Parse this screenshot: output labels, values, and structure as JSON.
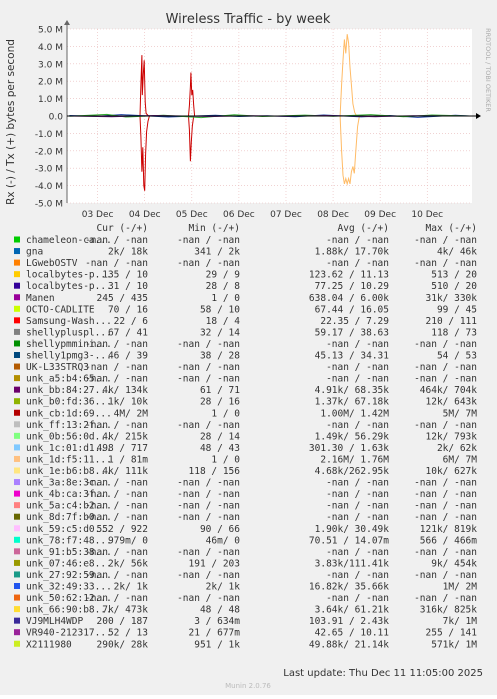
{
  "chart_data": {
    "type": "line",
    "title": "Wireless Traffic - by week",
    "ylabel": "Rx (-) / Tx (+) bytes per second",
    "side_label": "RRDTOOL / TOBI OETIKER",
    "ylim": [
      -5000000,
      5000000
    ],
    "y_ticks": [
      {
        "value": 5000000,
        "label": "5.0 M"
      },
      {
        "value": 4000000,
        "label": "4.0 M"
      },
      {
        "value": 3000000,
        "label": "3.0 M"
      },
      {
        "value": 2000000,
        "label": "2.0 M"
      },
      {
        "value": 1000000,
        "label": "1.0 M"
      },
      {
        "value": 0,
        "label": "0.0"
      },
      {
        "value": -1000000,
        "label": "-1.0 M"
      },
      {
        "value": -2000000,
        "label": "-2.0 M"
      },
      {
        "value": -3000000,
        "label": "-3.0 M"
      },
      {
        "value": -4000000,
        "label": "-4.0 M"
      },
      {
        "value": -5000000,
        "label": "-5.0 M"
      }
    ],
    "xlim": [
      2.35,
      10.95
    ],
    "x_ticks": [
      {
        "value": 3,
        "label": "03 Dec"
      },
      {
        "value": 4,
        "label": "04 Dec"
      },
      {
        "value": 5,
        "label": "05 Dec"
      },
      {
        "value": 6,
        "label": "06 Dec"
      },
      {
        "value": 7,
        "label": "07 Dec"
      },
      {
        "value": 8,
        "label": "08 Dec"
      },
      {
        "value": 9,
        "label": "09 Dec"
      },
      {
        "value": 10,
        "label": "10 Dec"
      }
    ],
    "grid": true,
    "series": [
      {
        "name": "red_tx",
        "color": "#cc0000",
        "points": [
          [
            3.9,
            0
          ],
          [
            3.92,
            1800000
          ],
          [
            3.94,
            3500000
          ],
          [
            3.95,
            1200000
          ],
          [
            3.97,
            2400000
          ],
          [
            3.99,
            3200000
          ],
          [
            4.01,
            800000
          ],
          [
            4.03,
            150000
          ],
          [
            4.08,
            0
          ],
          [
            4.93,
            0
          ],
          [
            4.95,
            600000
          ],
          [
            4.97,
            1700000
          ],
          [
            4.98,
            2500000
          ],
          [
            5.0,
            1200000
          ],
          [
            5.02,
            1500000
          ],
          [
            5.04,
            600000
          ],
          [
            5.06,
            0
          ]
        ]
      },
      {
        "name": "red_rx",
        "color": "#cc0000",
        "points": [
          [
            3.9,
            0
          ],
          [
            3.92,
            -1200000
          ],
          [
            3.94,
            -3200000
          ],
          [
            3.96,
            -1800000
          ],
          [
            3.98,
            -4000000
          ],
          [
            4.0,
            -4300000
          ],
          [
            4.02,
            -2200000
          ],
          [
            4.04,
            -900000
          ],
          [
            4.07,
            -300000
          ],
          [
            4.1,
            0
          ],
          [
            4.93,
            0
          ],
          [
            4.95,
            -800000
          ],
          [
            4.97,
            -2600000
          ],
          [
            4.99,
            -1500000
          ],
          [
            5.01,
            -600000
          ],
          [
            5.04,
            0
          ]
        ]
      },
      {
        "name": "orange_tx",
        "color": "#ffbb66",
        "points": [
          [
            8.15,
            0
          ],
          [
            8.18,
            1800000
          ],
          [
            8.21,
            3200000
          ],
          [
            8.24,
            4400000
          ],
          [
            8.27,
            3600000
          ],
          [
            8.3,
            4700000
          ],
          [
            8.33,
            4200000
          ],
          [
            8.36,
            2800000
          ],
          [
            8.39,
            1800000
          ],
          [
            8.42,
            700000
          ],
          [
            8.46,
            200000
          ],
          [
            8.5,
            0
          ]
        ]
      },
      {
        "name": "orange_rx",
        "color": "#ffbb66",
        "points": [
          [
            8.15,
            0
          ],
          [
            8.18,
            -2000000
          ],
          [
            8.21,
            -3400000
          ],
          [
            8.24,
            -3900000
          ],
          [
            8.27,
            -3600000
          ],
          [
            8.3,
            -3900000
          ],
          [
            8.33,
            -3600000
          ],
          [
            8.36,
            -3900000
          ],
          [
            8.39,
            -3200000
          ],
          [
            8.42,
            -2900000
          ],
          [
            8.45,
            -3300000
          ],
          [
            8.48,
            -2100000
          ],
          [
            8.52,
            -600000
          ],
          [
            8.56,
            0
          ]
        ]
      },
      {
        "name": "baseline_blue",
        "color": "#1a3fa0",
        "points": [
          [
            2.4,
            30000
          ],
          [
            3.0,
            -20000
          ],
          [
            3.5,
            80000
          ],
          [
            4.5,
            -60000
          ],
          [
            5.5,
            40000
          ],
          [
            6.0,
            -30000
          ],
          [
            6.6,
            20000
          ],
          [
            7.2,
            -40000
          ],
          [
            7.8,
            60000
          ],
          [
            8.6,
            -50000
          ],
          [
            9.2,
            30000
          ],
          [
            9.8,
            -80000
          ],
          [
            10.6,
            40000
          ],
          [
            10.9,
            0
          ]
        ]
      },
      {
        "name": "baseline_green",
        "color": "#33aa33",
        "points": [
          [
            2.4,
            -20000
          ],
          [
            3.2,
            90000
          ],
          [
            3.6,
            -60000
          ],
          [
            4.4,
            40000
          ],
          [
            5.2,
            -90000
          ],
          [
            5.9,
            70000
          ],
          [
            6.5,
            -30000
          ],
          [
            7.4,
            50000
          ],
          [
            8.0,
            -20000
          ],
          [
            8.8,
            80000
          ],
          [
            9.5,
            -40000
          ],
          [
            10.1,
            60000
          ],
          [
            10.9,
            0
          ]
        ]
      },
      {
        "name": "baseline_purple",
        "color": "#6a1a8a",
        "points": [
          [
            2.4,
            0
          ],
          [
            3.3,
            -40000
          ],
          [
            4.2,
            30000
          ],
          [
            5.4,
            -30000
          ],
          [
            6.3,
            20000
          ],
          [
            7.0,
            -20000
          ],
          [
            7.9,
            30000
          ],
          [
            8.9,
            -40000
          ],
          [
            9.7,
            20000
          ],
          [
            10.9,
            0
          ]
        ]
      }
    ]
  },
  "legend": {
    "headers": {
      "cur": "Cur (-/+)",
      "min": "Min (-/+)",
      "avg": "Avg (-/+)",
      "max": "Max (-/+)"
    },
    "rows": [
      {
        "color": "#00cc00",
        "name": "chameleon-ca...",
        "cur": "-nan / -nan",
        "min": "-nan / -nan",
        "avg": "-nan / -nan",
        "max": "-nan / -nan"
      },
      {
        "color": "#0066b3",
        "name": "gna",
        "cur": "2k/  18k",
        "min": "341 /   2k",
        "avg": "1.88k/ 17.70k",
        "max": "4k/  46k"
      },
      {
        "color": "#ff8000",
        "name": "LGwebOSTV",
        "cur": "-nan / -nan",
        "min": "-nan / -nan",
        "avg": "-nan / -nan",
        "max": "-nan / -nan"
      },
      {
        "color": "#ffcc00",
        "name": "localbytes-p...",
        "cur": "135 /   10",
        "min": "29 /    9",
        "avg": "123.62 / 11.13",
        "max": "513 /   20"
      },
      {
        "color": "#330099",
        "name": "localbytes-p...",
        "cur": "31 /   10",
        "min": "28 /    8",
        "avg": "77.25 / 10.29",
        "max": "510 /   20"
      },
      {
        "color": "#990099",
        "name": "Manen",
        "cur": "245 /  435",
        "min": "1 /    0",
        "avg": "638.04 /  6.00k",
        "max": "31k/ 330k"
      },
      {
        "color": "#ccff00",
        "name": "OCTO-CADLITE",
        "cur": "70 /   16",
        "min": "58 /   10",
        "avg": "67.44 / 16.05",
        "max": "99 /   45"
      },
      {
        "color": "#ff0000",
        "name": "Samsung-Wash...",
        "cur": "22 /    6",
        "min": "18 /    4",
        "avg": "22.35 /  7.29",
        "max": "210 /  111"
      },
      {
        "color": "#808080",
        "name": "shellypluspl...",
        "cur": "67 /   41",
        "min": "32 /   14",
        "avg": "59.17 / 38.63",
        "max": "118 /   73"
      },
      {
        "color": "#008f00",
        "name": "shellypmmini...",
        "cur": "-nan / -nan",
        "min": "-nan / -nan",
        "avg": "-nan / -nan",
        "max": "-nan / -nan"
      },
      {
        "color": "#00487d",
        "name": "shelly1pmg3-...",
        "cur": "46 /   39",
        "min": "38 /   28",
        "avg": "45.13 / 34.31",
        "max": "54 /   53"
      },
      {
        "color": "#b35a00",
        "name": "UK-L33STRQ3",
        "cur": "-nan / -nan",
        "min": "-nan / -nan",
        "avg": "-nan / -nan",
        "max": "-nan / -nan"
      },
      {
        "color": "#b38f00",
        "name": "unk_a5:b4:65...",
        "cur": "-nan / -nan",
        "min": "-nan / -nan",
        "avg": "-nan / -nan",
        "max": "-nan / -nan"
      },
      {
        "color": "#6b006b",
        "name": "unk_bb:84:27...",
        "cur": "4k/ 134k",
        "min": "61 /   71",
        "avg": "4.91k/ 68.35k",
        "max": "464k/ 704k"
      },
      {
        "color": "#8fb300",
        "name": "unk_b0:fd:36...",
        "cur": "1k/  10k",
        "min": "28 /   16",
        "avg": "1.37k/ 67.18k",
        "max": "12k/ 643k"
      },
      {
        "color": "#b30000",
        "name": "unk_cb:1d:69...",
        "cur": "4M/   2M",
        "min": "1 /    0",
        "avg": "1.00M/  1.42M",
        "max": "5M/   7M"
      },
      {
        "color": "#bebebe",
        "name": "unk_ff:13:2f...",
        "cur": "-nan / -nan",
        "min": "-nan / -nan",
        "avg": "-nan / -nan",
        "max": "-nan / -nan"
      },
      {
        "color": "#80ff80",
        "name": "unk_0b:56:0d...",
        "cur": "4k/ 215k",
        "min": "28 /   14",
        "avg": "1.49k/ 56.29k",
        "max": "12k/ 793k"
      },
      {
        "color": "#80c9ff",
        "name": "unk_1c:01:d1...",
        "cur": "498 /  717",
        "min": "48 /   43",
        "avg": "301.30 /  1.63k",
        "max": "2k/  62k"
      },
      {
        "color": "#ffc080",
        "name": "unk_1d:f5:11...",
        "cur": "1 /  81m",
        "min": "1 /    0",
        "avg": "2.16M/  1.76M",
        "max": "6M/   7M"
      },
      {
        "color": "#ffe680",
        "name": "unk_1e:b6:b8...",
        "cur": "4k/ 111k",
        "min": "118 /  156",
        "avg": "4.68k/262.95k",
        "max": "10k/ 627k"
      },
      {
        "color": "#aa80ff",
        "name": "unk_3a:8e:3c...",
        "cur": "-nan / -nan",
        "min": "-nan / -nan",
        "avg": "-nan / -nan",
        "max": "-nan / -nan"
      },
      {
        "color": "#ee00cc",
        "name": "unk_4b:ca:3f...",
        "cur": "-nan / -nan",
        "min": "-nan / -nan",
        "avg": "-nan / -nan",
        "max": "-nan / -nan"
      },
      {
        "color": "#ff8080",
        "name": "unk_5a:c4:b2...",
        "cur": "-nan / -nan",
        "min": "-nan / -nan",
        "avg": "-nan / -nan",
        "max": "-nan / -nan"
      },
      {
        "color": "#666600",
        "name": "unk_8d:7f:b0...",
        "cur": "-nan / -nan",
        "min": "-nan / -nan",
        "avg": "-nan / -nan",
        "max": "-nan / -nan"
      },
      {
        "color": "#ffbfff",
        "name": "unk_59:c5:d0...",
        "cur": "552 /  922",
        "min": "90 /   66",
        "avg": "1.90k/ 30.49k",
        "max": "121k/ 819k"
      },
      {
        "color": "#00ffcc",
        "name": "unk_78:f7:48...",
        "cur": "979m/    0",
        "min": "46m/    0",
        "avg": "70.51 / 14.07m",
        "max": "566 / 466m"
      },
      {
        "color": "#cc6699",
        "name": "unk_91:b5:38...",
        "cur": "-nan / -nan",
        "min": "-nan / -nan",
        "avg": "-nan / -nan",
        "max": "-nan / -nan"
      },
      {
        "color": "#999900",
        "name": "unk_07:46:e8...",
        "cur": "2k/  56k",
        "min": "191 /  203",
        "avg": "3.83k/111.41k",
        "max": "9k/ 454k"
      },
      {
        "color": "#1a9a88",
        "name": "unk_27:92:59...",
        "cur": "-nan / -nan",
        "min": "-nan / -nan",
        "avg": "-nan / -nan",
        "max": "-nan / -nan"
      },
      {
        "color": "#2255ee",
        "name": "unk_32:49:33...",
        "cur": "2k/   1k",
        "min": "2k/   1k",
        "avg": "16.82k/ 35.66k",
        "max": "1M/   2M"
      },
      {
        "color": "#ee6611",
        "name": "unk_50:62:12...",
        "cur": "-nan / -nan",
        "min": "-nan / -nan",
        "avg": "-nan / -nan",
        "max": "-nan / -nan"
      },
      {
        "color": "#ffdd33",
        "name": "unk_66:90:b8...",
        "cur": "7k/ 473k",
        "min": "48 /   48",
        "avg": "3.64k/ 61.21k",
        "max": "316k/ 825k"
      },
      {
        "color": "#3a2a99",
        "name": "VJ9MLH4WDP",
        "cur": "200 /  187",
        "min": "3 / 634m",
        "avg": "103.91 /  2.43k",
        "max": "7k/   1M"
      },
      {
        "color": "#992299",
        "name": "VR940-212317...",
        "cur": "52 /   13",
        "min": "21 / 677m",
        "avg": "42.65 / 10.11",
        "max": "255 /  141"
      },
      {
        "color": "#ccee22",
        "name": "X2111980",
        "cur": "290k/  28k",
        "min": "951 /   1k",
        "avg": "49.88k/ 21.14k",
        "max": "571k/   1M"
      }
    ]
  },
  "footer": {
    "last_update": "Last update: Thu Dec 11 11:05:00 2025",
    "munin": "Munin 2.0.76"
  }
}
